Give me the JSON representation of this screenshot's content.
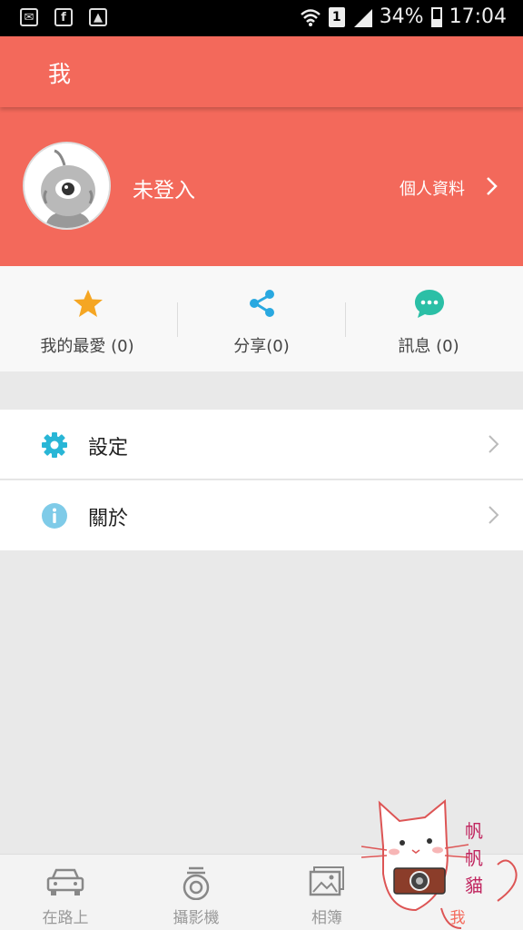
{
  "status_bar": {
    "battery": "34%",
    "time": "17:04",
    "sim": "1"
  },
  "app_bar": {
    "title": "我"
  },
  "profile": {
    "login_status": "未登入",
    "profile_link": "個人資料"
  },
  "stats": [
    {
      "label": "我的最愛 (0)",
      "icon": "star-icon"
    },
    {
      "label": "分享(0)",
      "icon": "share-icon"
    },
    {
      "label": "訊息 (0)",
      "icon": "message-icon"
    }
  ],
  "menu": [
    {
      "label": "設定",
      "icon": "gear-icon"
    },
    {
      "label": "關於",
      "icon": "info-icon"
    }
  ],
  "bottom_nav": [
    {
      "label": "在路上",
      "icon": "car-icon"
    },
    {
      "label": "攝影機",
      "icon": "camera-icon"
    },
    {
      "label": "相簿",
      "icon": "album-icon"
    },
    {
      "label": "我",
      "icon": "me-icon",
      "active": true
    }
  ],
  "sticker": {
    "text": "帆帆貓"
  },
  "colors": {
    "primary": "#f3695b",
    "star": "#f5a623",
    "share": "#29a8e0",
    "message": "#2bbfa6",
    "gear": "#29b6d6",
    "info": "#7fcbe8"
  }
}
